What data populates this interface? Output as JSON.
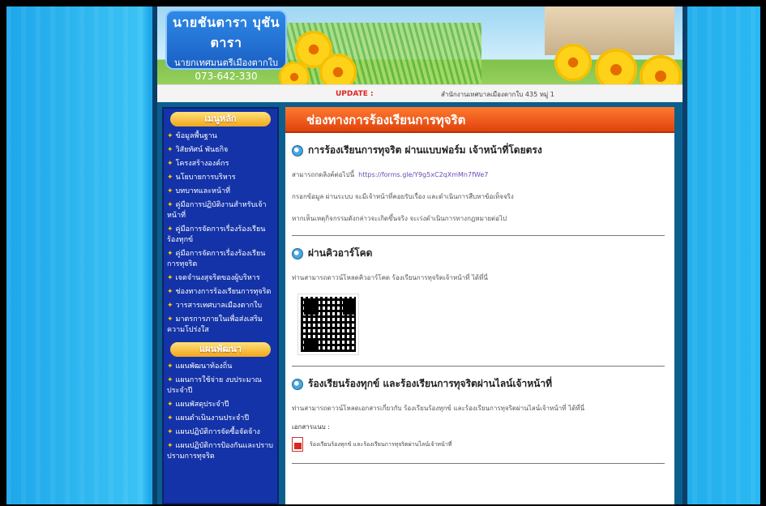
{
  "header": {
    "mayor_name": "นายชันตารา บุชันตารา",
    "mayor_title": "นายกเทศมนตรีเมืองตากใบ",
    "mayor_phone": "073-642-330",
    "update_label": "UPDATE :",
    "update_text": "สำนักงานเทศบาลเมืองตากใบ 435 หมู่ 1"
  },
  "sidebar": {
    "main_menu_title": "เมนูหลัก",
    "main_items": [
      "ข้อมูลพื้นฐาน",
      "วิสัยทัศน์ พันธกิจ",
      "โครงสร้างองค์กร",
      "นโยบายการบริหาร",
      "บทบาทและหน้าที่",
      "คู่มือการปฏิบัติงานสำหรับเจ้าหน้าที่",
      "คู่มือการจัดการเรื่องร้องเรียนร้องทุกข์",
      "คู่มือการจัดการเรื่องร้องเรียนการทุจริต",
      "เจตจำนงสุจริตของผู้บริหาร",
      "ช่องทางการร้องเรียนการทุจริต",
      "วารสารเทศบาลเมืองตากใบ",
      "มาตรการภายในเพื่อส่งเสริมความโปร่งใส"
    ],
    "plan_menu_title": "แผนพัฒนา",
    "plan_items": [
      "แผนพัฒนาท้องถิ่น",
      "แผนการใช้จ่าย งบประมาณประจำปี",
      "แผนพัสดุประจำปี",
      "แผนดำเนินงานประจำปี",
      "แผนปฏิบัติการจัดซื้อจัดจ้าง",
      "แผนปฏิบัติการป้องกันและปราบปรามการทุจริต"
    ]
  },
  "content": {
    "banner": "ช่องทางการร้องเรียนการทุจริต",
    "s1_title": "การร้องเรียนการทุจริต ผ่านแบบฟอร์ม เจ้าหน้าที่โดยตรง",
    "s1_p1_prefix": "สามารถกดลิงค์ต่อไปนี้",
    "s1_link": "https://forms.gle/Y9g5xC2qXmMn7fWe7",
    "s1_p2": "กรอกข้อมูล ผ่านระบบ จะมีเจ้าหน้าที่คอยรับเรื่อง และดำเนินการสืบหาข้อเท็จจริง",
    "s1_p3": "หากเห็นเหตุกิจกรรมดังกล่าวจะเกิดขึ้นจริง จะเร่งดำเนินการทางกฎหมายต่อไป",
    "s2_title": "ผ่านคิวอาร์โคด",
    "s2_p1": "ท่านสามารถดาวน์โหลดคิวอาร์โคด ร้องเรียนการทุจริตเจ้าหน้าที่ ได้ที่นี่",
    "s3_title": "ร้องเรียนร้องทุกข์ และร้องเรียนการทุจริตผ่านไลน์เจ้าหน้าที่",
    "s3_p1": "ท่านสามารถดาวน์โหลดเอกสารเกี่ยวกับ ร้องเรียนร้องทุกข์ และร้องเรียนการทุจริตผ่านไลน์เจ้าหน้าที่ ได้ที่นี่",
    "s3_doc_label": "เอกสารแนบ :",
    "s3_doc_link": "ร้องเรียนร้องทุกข์ และร้องเรียนการทุจริตผ่านไลน์เจ้าหน้าที่"
  }
}
